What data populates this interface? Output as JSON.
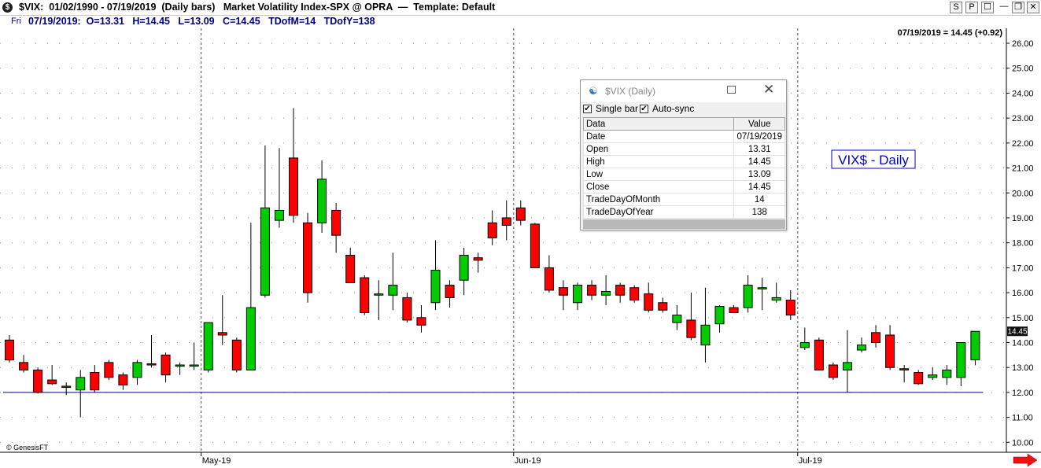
{
  "title_bar": {
    "icon_glyph": "$",
    "text": "$VIX:  01/02/1990 - 07/19/2019  (Daily bars)   Market Volatility Index-SPX @ OPRA  —  Template: Default",
    "buttons": [
      "S",
      "P",
      "☐",
      "—",
      "❐",
      "✕"
    ]
  },
  "info_bar": {
    "day": "Fri",
    "text": "07/19/2019:  O=13.31   H=14.45   L=13.09   C=14.45   TDofM=14   TDofY=138"
  },
  "chart_data": {
    "type": "candlestick",
    "symbol_label": "VIX$ - Daily",
    "header_readout": "07/19/2019 = 14.45 (+0.92)",
    "last_price_label": "14.45",
    "copyright": "© GenesisFT",
    "ylim": [
      9.6,
      26.6
    ],
    "y_ticks": [
      "26.00",
      "25.00",
      "24.00",
      "23.00",
      "22.00",
      "21.00",
      "20.00",
      "19.00",
      "18.00",
      "17.00",
      "16.00",
      "15.00",
      "14.00",
      "13.00",
      "12.00",
      "11.00",
      "10.00"
    ],
    "x_labels": [
      {
        "label": "May-19",
        "bar_index": 14
      },
      {
        "label": "Jun-19",
        "bar_index": 36
      },
      {
        "label": "Jul-19",
        "bar_index": 56
      }
    ],
    "horizontal_line": 12.0,
    "colors": {
      "up": "#00cc00",
      "down": "#ff0000",
      "wick": "#000000",
      "grid_dot": "#909090",
      "hline": "#000080",
      "label_box": "#0000cc"
    },
    "bars": [
      {
        "date": "04/11/2019",
        "o": 14.1,
        "h": 14.3,
        "l": 13.2,
        "c": 13.3
      },
      {
        "date": "04/12/2019",
        "o": 13.2,
        "h": 13.5,
        "l": 12.8,
        "c": 12.9
      },
      {
        "date": "04/15/2019",
        "o": 12.9,
        "h": 13.0,
        "l": 11.95,
        "c": 12.0
      },
      {
        "date": "04/16/2019",
        "o": 12.5,
        "h": 13.1,
        "l": 12.3,
        "c": 12.35
      },
      {
        "date": "04/17/2019",
        "o": 12.25,
        "h": 12.4,
        "l": 11.9,
        "c": 12.2
      },
      {
        "date": "04/18/2019",
        "o": 12.1,
        "h": 12.9,
        "l": 11.0,
        "c": 12.6
      },
      {
        "date": "04/22/2019",
        "o": 12.8,
        "h": 13.1,
        "l": 12.0,
        "c": 12.1
      },
      {
        "date": "04/23/2019",
        "o": 13.2,
        "h": 13.3,
        "l": 12.5,
        "c": 12.6
      },
      {
        "date": "04/24/2019",
        "o": 12.7,
        "h": 12.8,
        "l": 12.1,
        "c": 12.3
      },
      {
        "date": "04/25/2019",
        "o": 12.6,
        "h": 13.3,
        "l": 12.3,
        "c": 13.2
      },
      {
        "date": "04/26/2019",
        "o": 13.15,
        "h": 14.3,
        "l": 13.0,
        "c": 13.1
      },
      {
        "date": "04/29/2019",
        "o": 13.5,
        "h": 13.6,
        "l": 12.4,
        "c": 12.7
      },
      {
        "date": "04/30/2019",
        "o": 13.05,
        "h": 13.2,
        "l": 12.7,
        "c": 13.1
      },
      {
        "date": "05/01/2019",
        "o": 13.1,
        "h": 14.0,
        "l": 12.9,
        "c": 13.1
      },
      {
        "date": "05/02/2019",
        "o": 12.9,
        "h": 14.8,
        "l": 12.8,
        "c": 14.8
      },
      {
        "date": "05/03/2019",
        "o": 14.4,
        "h": 15.9,
        "l": 13.9,
        "c": 14.3
      },
      {
        "date": "05/06/2019",
        "o": 14.1,
        "h": 14.2,
        "l": 12.8,
        "c": 12.9
      },
      {
        "date": "05/07/2019",
        "o": 12.9,
        "h": 18.8,
        "l": 12.9,
        "c": 15.4
      },
      {
        "date": "05/08/2019",
        "o": 15.9,
        "h": 21.9,
        "l": 15.8,
        "c": 19.4
      },
      {
        "date": "05/09/2019",
        "o": 18.9,
        "h": 21.8,
        "l": 18.6,
        "c": 19.3
      },
      {
        "date": "05/10/2019",
        "o": 21.4,
        "h": 23.4,
        "l": 18.8,
        "c": 19.1
      },
      {
        "date": "05/13/2019",
        "o": 18.8,
        "h": 19.2,
        "l": 15.6,
        "c": 16.0
      },
      {
        "date": "05/14/2019",
        "o": 18.8,
        "h": 21.3,
        "l": 18.4,
        "c": 20.55
      },
      {
        "date": "05/15/2019",
        "o": 19.3,
        "h": 19.6,
        "l": 17.6,
        "c": 18.3
      },
      {
        "date": "05/16/2019",
        "o": 17.5,
        "h": 17.8,
        "l": 16.4,
        "c": 16.4
      },
      {
        "date": "05/17/2019",
        "o": 16.6,
        "h": 16.7,
        "l": 15.1,
        "c": 15.2
      },
      {
        "date": "05/20/2019",
        "o": 15.9,
        "h": 16.5,
        "l": 14.9,
        "c": 15.95
      },
      {
        "date": "05/21/2019",
        "o": 15.9,
        "h": 17.6,
        "l": 15.3,
        "c": 16.3
      },
      {
        "date": "05/22/2019",
        "o": 15.8,
        "h": 16.0,
        "l": 14.8,
        "c": 14.9
      },
      {
        "date": "05/23/2019",
        "o": 15.0,
        "h": 15.5,
        "l": 14.4,
        "c": 14.7
      },
      {
        "date": "05/24/2019",
        "o": 15.6,
        "h": 18.1,
        "l": 15.3,
        "c": 16.9
      },
      {
        "date": "05/28/2019",
        "o": 16.3,
        "h": 16.5,
        "l": 15.4,
        "c": 15.8
      },
      {
        "date": "05/29/2019",
        "o": 16.5,
        "h": 17.8,
        "l": 15.9,
        "c": 17.5
      },
      {
        "date": "05/30/2019",
        "o": 17.4,
        "h": 17.6,
        "l": 16.8,
        "c": 17.3
      },
      {
        "date": "05/31/2019",
        "o": 18.8,
        "h": 19.3,
        "l": 17.9,
        "c": 18.2
      },
      {
        "date": "06/03/2019",
        "o": 19.0,
        "h": 19.7,
        "l": 18.1,
        "c": 18.7
      },
      {
        "date": "06/04/2019",
        "o": 19.4,
        "h": 19.7,
        "l": 18.7,
        "c": 18.9
      },
      {
        "date": "06/05/2019",
        "o": 18.75,
        "h": 18.8,
        "l": 17.0,
        "c": 17.0
      },
      {
        "date": "06/06/2019",
        "o": 17.0,
        "h": 17.5,
        "l": 16.0,
        "c": 16.1
      },
      {
        "date": "06/07/2019",
        "o": 16.2,
        "h": 16.5,
        "l": 15.3,
        "c": 15.9
      },
      {
        "date": "06/10/2019",
        "o": 15.6,
        "h": 16.4,
        "l": 15.3,
        "c": 16.3
      },
      {
        "date": "06/11/2019",
        "o": 16.3,
        "h": 16.5,
        "l": 15.7,
        "c": 15.9
      },
      {
        "date": "06/12/2019",
        "o": 15.9,
        "h": 16.7,
        "l": 15.5,
        "c": 16.05
      },
      {
        "date": "06/13/2019",
        "o": 16.3,
        "h": 16.4,
        "l": 15.6,
        "c": 15.9
      },
      {
        "date": "06/14/2019",
        "o": 16.2,
        "h": 16.3,
        "l": 15.6,
        "c": 15.7
      },
      {
        "date": "06/17/2019",
        "o": 15.95,
        "h": 16.4,
        "l": 15.2,
        "c": 15.3
      },
      {
        "date": "06/18/2019",
        "o": 15.6,
        "h": 15.8,
        "l": 15.2,
        "c": 15.3
      },
      {
        "date": "06/19/2019",
        "o": 14.8,
        "h": 15.5,
        "l": 14.5,
        "c": 15.1
      },
      {
        "date": "06/20/2019",
        "o": 14.9,
        "h": 16.0,
        "l": 14.1,
        "c": 14.2
      },
      {
        "date": "06/21/2019",
        "o": 13.9,
        "h": 16.2,
        "l": 13.2,
        "c": 14.7
      },
      {
        "date": "06/24/2019",
        "o": 14.75,
        "h": 15.5,
        "l": 14.4,
        "c": 15.45
      },
      {
        "date": "06/25/2019",
        "o": 15.4,
        "h": 15.5,
        "l": 15.2,
        "c": 15.2
      },
      {
        "date": "06/26/2019",
        "o": 15.4,
        "h": 16.7,
        "l": 15.2,
        "c": 16.3
      },
      {
        "date": "06/27/2019",
        "o": 16.15,
        "h": 16.6,
        "l": 15.3,
        "c": 16.2
      },
      {
        "date": "06/28/2019",
        "o": 15.7,
        "h": 16.4,
        "l": 15.6,
        "c": 15.8
      },
      {
        "date": "07/01/2019",
        "o": 15.7,
        "h": 16.1,
        "l": 14.9,
        "c": 15.1
      },
      {
        "date": "07/02/2019",
        "o": 13.8,
        "h": 14.6,
        "l": 13.7,
        "c": 14.0
      },
      {
        "date": "07/03/2019",
        "o": 14.1,
        "h": 14.2,
        "l": 12.9,
        "c": 12.9
      },
      {
        "date": "07/05/2019",
        "o": 13.1,
        "h": 13.2,
        "l": 12.5,
        "c": 12.6
      },
      {
        "date": "07/08/2019",
        "o": 12.9,
        "h": 14.5,
        "l": 12.0,
        "c": 13.2
      },
      {
        "date": "07/09/2019",
        "o": 13.7,
        "h": 14.2,
        "l": 13.6,
        "c": 13.9
      },
      {
        "date": "07/10/2019",
        "o": 14.4,
        "h": 14.7,
        "l": 13.8,
        "c": 14.0
      },
      {
        "date": "07/11/2019",
        "o": 14.3,
        "h": 14.7,
        "l": 12.9,
        "c": 13.0
      },
      {
        "date": "07/12/2019",
        "o": 12.95,
        "h": 13.1,
        "l": 12.4,
        "c": 12.9
      },
      {
        "date": "07/15/2019",
        "o": 12.8,
        "h": 12.9,
        "l": 12.3,
        "c": 12.35
      },
      {
        "date": "07/16/2019",
        "o": 12.6,
        "h": 13.0,
        "l": 12.5,
        "c": 12.7
      },
      {
        "date": "07/17/2019",
        "o": 12.6,
        "h": 13.1,
        "l": 12.3,
        "c": 12.9
      },
      {
        "date": "07/18/2019",
        "o": 12.6,
        "h": 14.0,
        "l": 12.25,
        "c": 14.0
      },
      {
        "date": "07/19/2019",
        "o": 13.31,
        "h": 14.45,
        "l": 13.09,
        "c": 14.45
      }
    ]
  },
  "data_window": {
    "title": "$VIX (Daily)",
    "single_bar_label": "Single bar",
    "auto_sync_label": "Auto-sync",
    "single_bar_checked": "✔",
    "auto_sync_checked": "✔",
    "headers": [
      "Data",
      "Value"
    ],
    "rows": [
      {
        "label": "Date",
        "value": "07/19/2019"
      },
      {
        "label": "Open",
        "value": "13.31"
      },
      {
        "label": "High",
        "value": "14.45"
      },
      {
        "label": "Low",
        "value": "13.09"
      },
      {
        "label": "Close",
        "value": "14.45"
      },
      {
        "label": "TradeDayOfMonth",
        "value": "14"
      },
      {
        "label": "TradeDayOfYear",
        "value": "138"
      }
    ]
  }
}
